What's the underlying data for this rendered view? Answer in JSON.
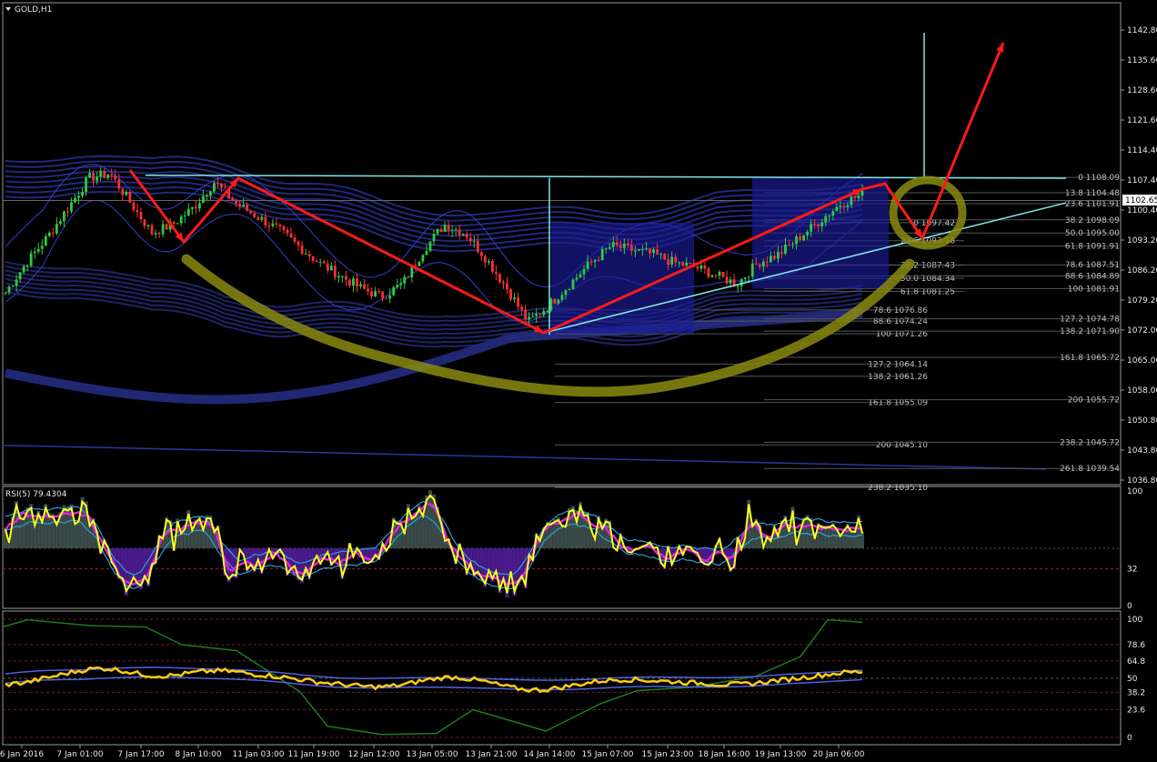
{
  "window": {
    "title": "GOLD,H1"
  },
  "rsi": {
    "label": "RSI(5) 79.4304",
    "levels": [
      "100",
      "32",
      "0"
    ]
  },
  "stoch": {
    "levels": [
      "100",
      "78.6",
      "64.8",
      "50",
      "38.2",
      "23.6",
      "0"
    ]
  },
  "price": {
    "current": "1102.65"
  },
  "colors": {
    "up": "#2ecc40",
    "down": "#ff3030",
    "arrow": "#ff1a1a",
    "arc": "#8a8a10",
    "box": "#1c1c9a",
    "cyan": "#7fe8e8",
    "band": "#1e2466"
  },
  "chart_data": {
    "type": "candlestick",
    "symbol": "GOLD",
    "timeframe": "H1",
    "y_ticks": [
      "1142.80",
      "1135.60",
      "1128.60",
      "1121.60",
      "1114.40",
      "1107.40",
      "1100.40",
      "1093.20",
      "1086.20",
      "1079.20",
      "1072.00",
      "1065.00",
      "1058.00",
      "1050.80",
      "1043.80",
      "1036.80"
    ],
    "x_ticks": [
      "6 Jan 2016",
      "7 Jan 01:00",
      "7 Jan 17:00",
      "8 Jan 10:00",
      "11 Jan 03:00",
      "11 Jan 19:00",
      "12 Jan 12:00",
      "13 Jan 05:00",
      "13 Jan 21:00",
      "14 Jan 14:00",
      "15 Jan 07:00",
      "15 Jan 23:00",
      "18 Jan 16:00",
      "19 Jan 13:00",
      "20 Jan 06:00"
    ],
    "ylim": [
      1033.6,
      1147.0
    ],
    "price_path": [
      1081,
      1088,
      1094,
      1101,
      1108,
      1109,
      1102,
      1095,
      1097,
      1101,
      1107,
      1102,
      1099,
      1096,
      1092,
      1088,
      1085,
      1082,
      1080,
      1083,
      1091,
      1097,
      1095,
      1089,
      1082,
      1074,
      1078,
      1083,
      1088,
      1092,
      1091,
      1090,
      1088,
      1087,
      1085,
      1083,
      1088,
      1090,
      1094,
      1098,
      1102,
      1104
    ],
    "fib_left": [
      {
        "label": "78.6 1076.86",
        "price": 1076.86
      },
      {
        "label": "88.6 1074.24",
        "price": 1074.24
      },
      {
        "label": "100 1071.26",
        "price": 1071.26
      },
      {
        "label": "127.2 1064.14",
        "price": 1064.14
      },
      {
        "label": "138.2 1061.26",
        "price": 1061.26
      },
      {
        "label": "161.8 1055.09",
        "price": 1055.09
      },
      {
        "label": "200 1045.10",
        "price": 1045.1
      },
      {
        "label": "238.2 1035.10",
        "price": 1035.1
      }
    ],
    "fib_mid": [
      {
        "label": "0 1097.42",
        "price": 1097.42
      },
      {
        "label": "23.6 1093.18",
        "price": 1093.18
      },
      {
        "label": "38.2 1087.43",
        "price": 1087.43
      },
      {
        "label": "50.0 1084.34",
        "price": 1084.34
      },
      {
        "label": "61.8 1081.25",
        "price": 1081.25
      }
    ],
    "fib_right": [
      {
        "label": "0 1108.09",
        "price": 1108.09
      },
      {
        "label": "13.8 1104.48",
        "price": 1104.48
      },
      {
        "label": "23.6 1101.91",
        "price": 1101.91
      },
      {
        "label": "38.2 1098.09",
        "price": 1098.09
      },
      {
        "label": "50.0 1095.00",
        "price": 1095.0
      },
      {
        "label": "61.8 1091.91",
        "price": 1091.91
      },
      {
        "label": "78.6 1087.51",
        "price": 1087.51
      },
      {
        "label": "88.6 1084.89",
        "price": 1084.89
      },
      {
        "label": "100 1081.91",
        "price": 1081.91
      },
      {
        "label": "127.2 1074.78",
        "price": 1074.78
      },
      {
        "label": "138.2 1071.90",
        "price": 1071.9
      },
      {
        "label": "161.8 1065.72",
        "price": 1065.72
      },
      {
        "label": "200 1055.72",
        "price": 1055.72
      },
      {
        "label": "238.2 1045.72",
        "price": 1045.72
      },
      {
        "label": "261.8 1039.54",
        "price": 1039.54
      }
    ],
    "rsi_value": 79.4304,
    "rsi_level": 32
  }
}
